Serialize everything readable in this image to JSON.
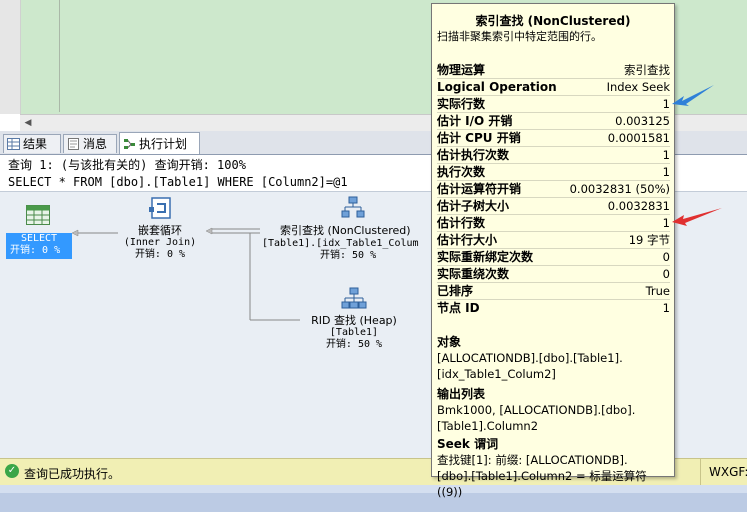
{
  "tabs": [
    {
      "label": "结果"
    },
    {
      "label": "消息"
    },
    {
      "label": "执行计划"
    }
  ],
  "plan": {
    "query_line": "查询 1: (与该批有关的) 查询开销: 100%",
    "sql_line": "SELECT * FROM [dbo].[Table1] WHERE [Column2]=@1",
    "nodes": {
      "select": {
        "name": "SELECT",
        "cost": "开销: 0 %"
      },
      "nested_loops": {
        "name": "嵌套循环",
        "sub": "(Inner Join)",
        "cost": "开销: 0 %"
      },
      "index_seek": {
        "name": "索引查找 (NonClustered)",
        "sub": "[Table1].[idx_Table1_Colum",
        "cost": "开销: 50 %"
      },
      "rid_lookup": {
        "name": "RID 查找 (Heap)",
        "sub": "[Table1]",
        "cost": "开销: 50 %"
      }
    }
  },
  "status": {
    "message": "查询已成功执行。",
    "server": "WXGF:"
  },
  "tooltip": {
    "title": "索引查找 (NonClustered)",
    "description": "扫描非聚集索引中特定范围的行。",
    "rows": [
      {
        "label": "物理运算",
        "value": "索引查找"
      },
      {
        "label": "Logical Operation",
        "value": "Index Seek"
      },
      {
        "label": "实际行数",
        "value": "1"
      },
      {
        "label": "估计 I/O 开销",
        "value": "0.003125"
      },
      {
        "label": "估计 CPU 开销",
        "value": "0.0001581"
      },
      {
        "label": "估计执行次数",
        "value": "1"
      },
      {
        "label": "执行次数",
        "value": "1"
      },
      {
        "label": "估计运算符开销",
        "value": "0.0032831 (50%)"
      },
      {
        "label": "估计子树大小",
        "value": "0.0032831"
      },
      {
        "label": "估计行数",
        "value": "1"
      },
      {
        "label": "估计行大小",
        "value": "19 字节"
      },
      {
        "label": "实际重新绑定次数",
        "value": "0"
      },
      {
        "label": "实际重绕次数",
        "value": "0"
      },
      {
        "label": "已排序",
        "value": "True"
      },
      {
        "label": "节点 ID",
        "value": "1"
      }
    ],
    "object_heading": "对象",
    "object_lines": [
      "[ALLOCATIONDB].[dbo].[Table1].",
      "[idx_Table1_Colum2]"
    ],
    "output_heading": "输出列表",
    "output_lines": [
      "Bmk1000, [ALLOCATIONDB].[dbo].",
      "[Table1].Column2"
    ],
    "seek_heading": "Seek 谓词",
    "seek_lines": [
      "查找键[1]: 前缀: [ALLOCATIONDB].",
      "[dbo].[Table1].Column2 = 标量运算符",
      "((9))"
    ]
  },
  "colors": {
    "editor_bg": "#cde8cc",
    "tooltip_bg": "#ffffe1",
    "status_bg": "#f1efb4",
    "selected_node": "#3399ff",
    "arrow_blue": "#2f80d8",
    "arrow_red": "#e03030"
  }
}
